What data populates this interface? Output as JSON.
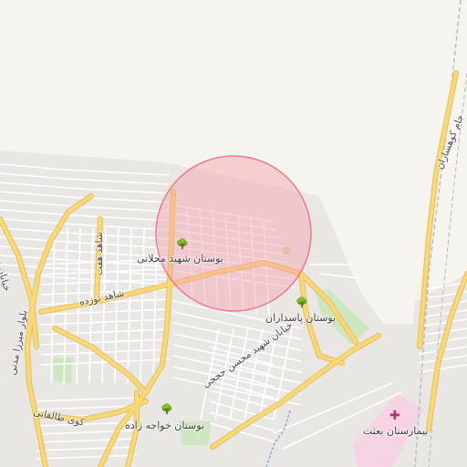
{
  "map": {
    "labels": {
      "park_shahid_mahallati": "بوستان شهید محلاتی",
      "park_pasdaran": "بوستان پاسداران",
      "park_khajeh_zadeh": "بوستان خواجه زاده",
      "hospital_besat": "بیمارستان بعثت",
      "street_shahid_mohsen_hojaji": "خیابان شهید محسن حججی",
      "street_shahed_norouzeh": "شاهد نوزده",
      "street_jam_kuhsaran": "جام کوهساران",
      "street_sardaran": "خیابان سرداران",
      "street_mirza_madani": "بلوار میرزا مدنی",
      "street_taleghani": "کوی طالقانی",
      "street_shahed_ekhteh": "شاهد هفت"
    },
    "icons": {
      "park": "tree-icon",
      "hospital": "hospital-cross-icon"
    },
    "colors": {
      "land": "#f6f4ef",
      "built_area": "#e9e7e3",
      "minor_road": "#ffffff",
      "major_road": "#f7d978",
      "major_road_casing": "#e9bd55",
      "park": "#cfe6c2",
      "hospital_area": "#f6d4e3",
      "rail": "#b9b9b9",
      "water": "#7fa6d9",
      "search_radius_fill": "#f3a2ab",
      "search_radius_stroke": "#e87d8a",
      "label_text": "#3f3f3f"
    },
    "search_radius_opacity": 0.45
  }
}
